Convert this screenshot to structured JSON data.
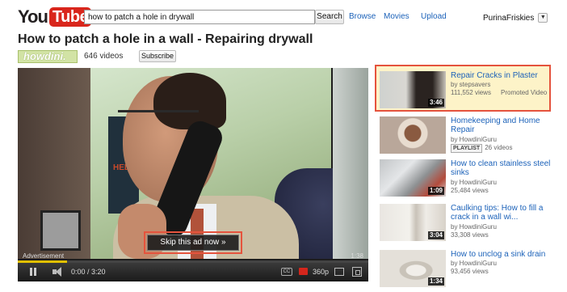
{
  "header": {
    "logo_you": "You",
    "logo_tube": "Tube",
    "search_value": "how to patch a hole in drywall",
    "search_button": "Search",
    "nav": [
      "Browse",
      "Movies",
      "Upload"
    ],
    "username": "PurinaFriskies",
    "user_menu_icon": "chevron-down-icon"
  },
  "video": {
    "title": "How to patch a hole in a wall - Repairing drywall",
    "channel_logo": "howdini.",
    "video_count": "646 videos",
    "subscribe": "Subscribe"
  },
  "scene": {
    "poster_text": "HELP HELP"
  },
  "player": {
    "skip_ad": "Skip this ad now »",
    "ad_label": "Advertisement",
    "ad_remaining": "1:38",
    "time": "0:00 / 3:20",
    "quality": "360p",
    "progress": 0.14,
    "cc_label": "CC"
  },
  "related": [
    {
      "title": "Repair Cracks in Plaster",
      "by": "by stepsavers",
      "views": "111,552 views",
      "duration": "3:46",
      "promoted": "Promoted Video"
    },
    {
      "title": "Homekeeping and Home Repair",
      "by": "by HowdiniGuru",
      "badge": "PLAYLIST",
      "views": "26 videos"
    },
    {
      "title": "How to clean stainless steel sinks",
      "by": "by HowdiniGuru",
      "views": "25,484 views",
      "duration": "1:09"
    },
    {
      "title": "Caulking tips: How to fill a crack in a wall wi...",
      "by": "by HowdiniGuru",
      "views": "33,308 views",
      "duration": "3:04"
    },
    {
      "title": "How to unclog a sink drain",
      "by": "by HowdiniGuru",
      "views": "93,456 views",
      "duration": "1:34"
    }
  ],
  "colors": {
    "link": "#1c62b9",
    "brand_red": "#d9261c",
    "highlight": "#e5533d",
    "promoted_bg": "#fdf3c8"
  }
}
